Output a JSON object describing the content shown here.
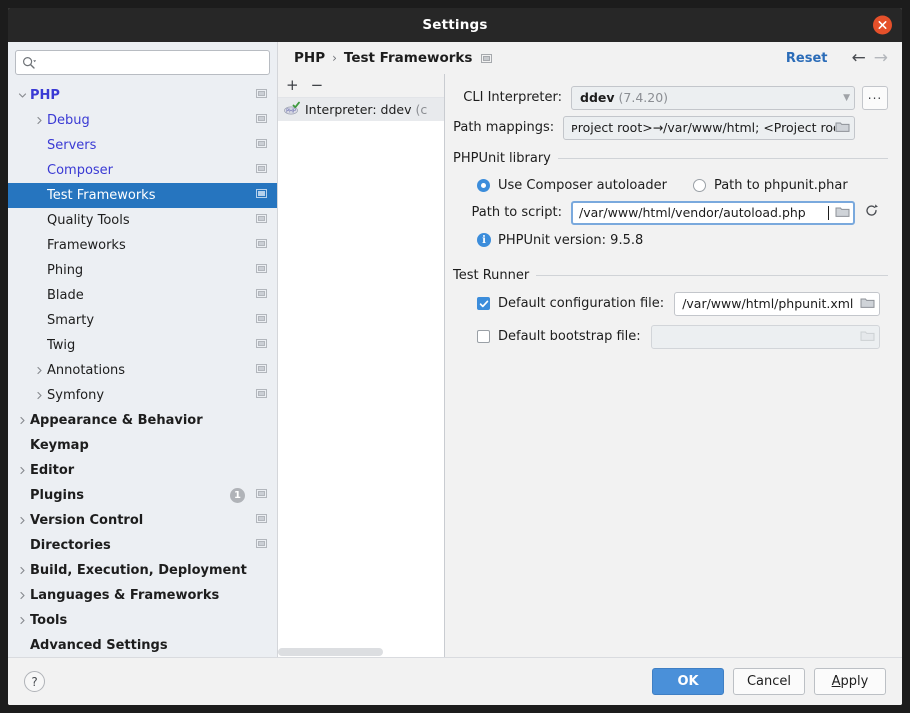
{
  "window": {
    "title": "Settings",
    "close_icon": "close-icon"
  },
  "sidebar": {
    "search": {
      "placeholder": "",
      "value": "",
      "icon": "search-icon"
    },
    "items": [
      {
        "label": "PHP",
        "indent": 0,
        "arrow": "down",
        "style": "mod bold",
        "copy": true
      },
      {
        "label": "Debug",
        "indent": 1,
        "arrow": "right",
        "style": "mod",
        "copy": true
      },
      {
        "label": "Servers",
        "indent": 1,
        "arrow": "none",
        "style": "mod",
        "copy": true
      },
      {
        "label": "Composer",
        "indent": 1,
        "arrow": "none",
        "style": "mod",
        "copy": true
      },
      {
        "label": "Test Frameworks",
        "indent": 1,
        "arrow": "none",
        "style": "sel",
        "copy": true
      },
      {
        "label": "Quality Tools",
        "indent": 1,
        "arrow": "none",
        "style": "",
        "copy": true
      },
      {
        "label": "Frameworks",
        "indent": 1,
        "arrow": "none",
        "style": "",
        "copy": true
      },
      {
        "label": "Phing",
        "indent": 1,
        "arrow": "none",
        "style": "",
        "copy": true
      },
      {
        "label": "Blade",
        "indent": 1,
        "arrow": "none",
        "style": "",
        "copy": true
      },
      {
        "label": "Smarty",
        "indent": 1,
        "arrow": "none",
        "style": "",
        "copy": true
      },
      {
        "label": "Twig",
        "indent": 1,
        "arrow": "none",
        "style": "",
        "copy": true
      },
      {
        "label": "Annotations",
        "indent": 1,
        "arrow": "right",
        "style": "",
        "copy": true
      },
      {
        "label": "Symfony",
        "indent": 1,
        "arrow": "right",
        "style": "",
        "copy": true
      },
      {
        "label": "Appearance & Behavior",
        "indent": 0,
        "arrow": "right",
        "style": "bold",
        "copy": false
      },
      {
        "label": "Keymap",
        "indent": 0,
        "arrow": "none",
        "style": "bold",
        "copy": false
      },
      {
        "label": "Editor",
        "indent": 0,
        "arrow": "right",
        "style": "bold",
        "copy": false
      },
      {
        "label": "Plugins",
        "indent": 0,
        "arrow": "none",
        "style": "bold",
        "copy": true,
        "badge": "1"
      },
      {
        "label": "Version Control",
        "indent": 0,
        "arrow": "right",
        "style": "bold",
        "copy": true
      },
      {
        "label": "Directories",
        "indent": 0,
        "arrow": "none",
        "style": "bold",
        "copy": true
      },
      {
        "label": "Build, Execution, Deployment",
        "indent": 0,
        "arrow": "right",
        "style": "bold",
        "copy": false
      },
      {
        "label": "Languages & Frameworks",
        "indent": 0,
        "arrow": "right",
        "style": "bold",
        "copy": false
      },
      {
        "label": "Tools",
        "indent": 0,
        "arrow": "right",
        "style": "bold",
        "copy": false
      },
      {
        "label": "Advanced Settings",
        "indent": 0,
        "arrow": "none",
        "style": "bold",
        "copy": false
      }
    ]
  },
  "header": {
    "breadcrumb_root": "PHP",
    "breadcrumb_separator": "›",
    "breadcrumb_current": "Test Frameworks",
    "breadcrumb_icon": "copy-settings-icon",
    "reset_label": "Reset",
    "back_icon": "arrow-left-icon",
    "forward_icon": "arrow-right-icon",
    "back_glyph": "←",
    "forward_glyph": "→"
  },
  "interpreter_list": {
    "add_label": "+",
    "remove_label": "−",
    "items": [
      {
        "icon": "php-checked-icon",
        "label": "Interpreter: ddev",
        "suffix": "(c"
      }
    ]
  },
  "form": {
    "cli_interpreter": {
      "label": "CLI Interpreter:",
      "value": "ddev",
      "value_suffix": "(7.4.20)",
      "caret_icon": "chevron-down-icon",
      "browse_label": "..."
    },
    "path_mappings": {
      "label": "Path mappings:",
      "value": "ᴘroject root>→/var/www/html; <Project root...",
      "browse_icon": "folder-icon"
    },
    "phpunit_library": {
      "title": "PHPUnit library",
      "radios": [
        {
          "label": "Use Composer autoloader",
          "checked": true
        },
        {
          "label": "Path to phpunit.phar",
          "checked": false
        }
      ],
      "path_to_script": {
        "label": "Path to script:",
        "value": "/var/www/html/vendor/autoload.php",
        "browse_icon": "folder-icon",
        "refresh_icon": "refresh-icon",
        "focused": true
      },
      "info": {
        "icon": "info-icon",
        "text": "PHPUnit version: 9.5.8"
      }
    },
    "test_runner": {
      "title": "Test Runner",
      "default_config": {
        "label": "Default configuration file:",
        "checked": true,
        "value": "/var/www/html/phpunit.xml",
        "browse_icon": "folder-icon"
      },
      "default_bootstrap": {
        "label": "Default bootstrap file:",
        "checked": false,
        "value": "",
        "browse_icon": "folder-icon"
      }
    }
  },
  "footer": {
    "help_label": "?",
    "help_icon": "help-icon",
    "ok_label": "OK",
    "cancel_label": "Cancel",
    "apply_label": "Apply",
    "apply_mnemonic": "A",
    "apply_rest": "pply"
  },
  "colors": {
    "accent": "#3c8ddb",
    "selection": "#2675bf",
    "link": "#2b6cb8",
    "modified": "#3a3ad4",
    "primary_button": "#4a90d9",
    "close_button": "#e5502a",
    "titlebar": "#272727"
  }
}
